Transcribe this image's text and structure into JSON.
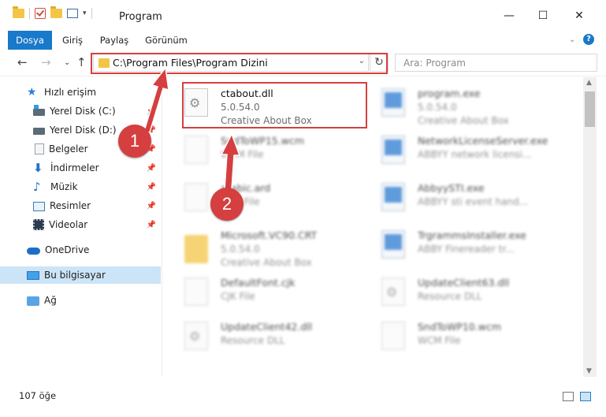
{
  "window": {
    "title": "Program",
    "minimize_icon": "minimize-icon",
    "maximize_icon": "maximize-icon",
    "close_icon": "close-icon"
  },
  "ribbon": {
    "tabs": [
      {
        "label": "Dosya",
        "active": true
      },
      {
        "label": "Giriş",
        "active": false
      },
      {
        "label": "Paylaş",
        "active": false
      },
      {
        "label": "Görünüm",
        "active": false
      }
    ]
  },
  "nav": {
    "address": "C:\\Program Files\\Program Dizini",
    "search_placeholder": "Ara: Program"
  },
  "sidebar": {
    "quick_access": "Hızlı erişim",
    "items": [
      {
        "label": "Yerel Disk (C:)",
        "icon": "disk-icon"
      },
      {
        "label": "Yerel Disk (D:)",
        "icon": "disk-icon"
      },
      {
        "label": "Belgeler",
        "icon": "documents-icon"
      },
      {
        "label": "İndirmeler",
        "icon": "downloads-icon"
      },
      {
        "label": "Müzik",
        "icon": "music-icon"
      },
      {
        "label": "Resimler",
        "icon": "pictures-icon"
      },
      {
        "label": "Videolar",
        "icon": "videos-icon"
      }
    ],
    "onedrive": "OneDrive",
    "this_pc": "Bu bilgisayar",
    "network": "Ağ"
  },
  "files": [
    {
      "name": "ctabout.dll",
      "line2": "5.0.54.0",
      "line3": "Creative About Box",
      "icon": "dll-file-icon",
      "blurred": false
    },
    {
      "name": "program.exe",
      "line2": "5.0.54.0",
      "line3": "Creative About Box",
      "icon": "exe-file-icon",
      "blurred": true
    },
    {
      "name": "SndToWP15.wcm",
      "line2": "WCM File",
      "line3": "",
      "icon": "file-icon",
      "blurred": true
    },
    {
      "name": "NetworkLicenseServer.exe",
      "line2": "ABBYY network licensi...",
      "line3": "",
      "icon": "exe-file-icon",
      "blurred": true
    },
    {
      "name": "arabic.ard",
      "line2": "ARD File",
      "line3": "",
      "icon": "file-icon",
      "blurred": true
    },
    {
      "name": "AbbyySTI.exe",
      "line2": "ABBYY sti event hand...",
      "line3": "",
      "icon": "exe-file-icon",
      "blurred": true
    },
    {
      "name": "Microsoft.VC90.CRT",
      "line2": "5.0.54.0",
      "line3": "Creative About Box",
      "icon": "folder-icon",
      "blurred": true
    },
    {
      "name": "TrgrammsInstaller.exe",
      "line2": "ABBY Finereader tr...",
      "line3": "",
      "icon": "exe-file-icon",
      "blurred": true
    },
    {
      "name": "DefaultFont.cjk",
      "line2": "CJK File",
      "line3": "",
      "icon": "file-icon",
      "blurred": true
    },
    {
      "name": "UpdateClient63.dll",
      "line2": "Resource DLL",
      "line3": "",
      "icon": "dll-file-icon",
      "blurred": true
    },
    {
      "name": "UpdateClient42.dll",
      "line2": "Resource DLL",
      "line3": "",
      "icon": "dll-file-icon",
      "blurred": true
    },
    {
      "name": "SndToWP10.wcm",
      "line2": "WCM File",
      "line3": "",
      "icon": "file-icon",
      "blurred": true
    }
  ],
  "status": {
    "count": "107 öğe"
  },
  "annotations": {
    "callout1": "1",
    "callout2": "2",
    "color": "#d53f3f"
  }
}
